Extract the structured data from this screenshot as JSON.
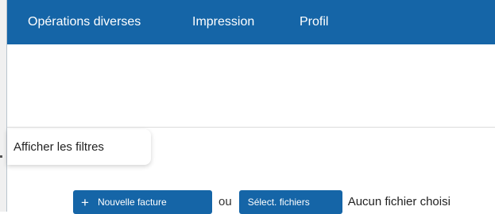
{
  "navbar": {
    "items": [
      {
        "label": "Opérations diverses"
      },
      {
        "label": "Impression"
      },
      {
        "label": "Profil"
      }
    ]
  },
  "filters": {
    "label": "Afficher les filtres"
  },
  "actions": {
    "new_invoice_icon": "+",
    "new_invoice_label": "Nouvelle facture",
    "or_label": "ou",
    "select_files_label": "Sélect. fichiers",
    "no_file_text": "Aucun fichier choisi"
  },
  "colors": {
    "primary": "#1565a7",
    "background": "#ffffff"
  }
}
